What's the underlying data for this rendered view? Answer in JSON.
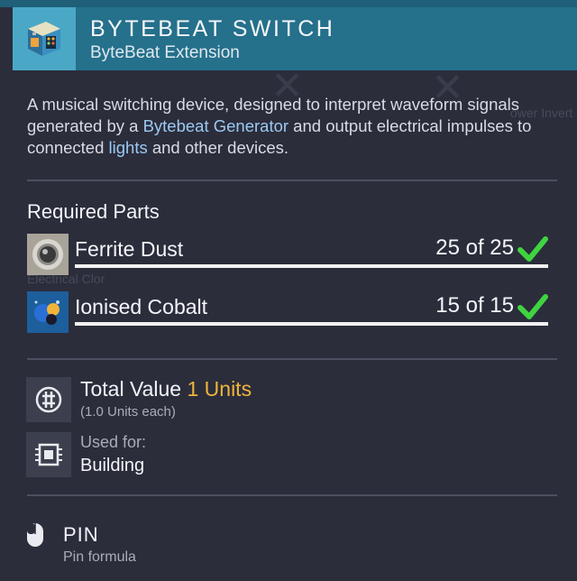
{
  "item": {
    "title": "BYTEBEAT SWITCH",
    "subtitle": "ByteBeat Extension",
    "icon": "bytebeat-switch-icon"
  },
  "description": {
    "prefix": "A musical switching device, designed to interpret waveform signals generated by a ",
    "link1": "Bytebeat Generator",
    "middle": " and output electrical impulses to connected ",
    "link2": "lights",
    "suffix": " and other devices."
  },
  "required_parts": {
    "title": "Required Parts",
    "items": [
      {
        "name": "Ferrite Dust",
        "count": "25 of 25",
        "icon": "ferrite-dust-icon",
        "complete": true
      },
      {
        "name": "Ionised Cobalt",
        "count": "15 of 15",
        "icon": "ionised-cobalt-icon",
        "complete": true
      }
    ]
  },
  "value": {
    "label": "Total Value",
    "amount": "1 Units",
    "each": "(1.0 Units each)",
    "icon": "units-icon"
  },
  "used_for": {
    "label": "Used for:",
    "value": "Building",
    "icon": "chip-icon"
  },
  "pin": {
    "label": "PIN",
    "sub": "Pin formula",
    "icon": "mouse-icon"
  },
  "background_text": {
    "right": "ower Invert",
    "left": "Electrical Clor"
  },
  "colors": {
    "accent": "#25708b",
    "units": "#f0b43b",
    "link": "#9cc9f2",
    "check": "#3fd43f"
  }
}
